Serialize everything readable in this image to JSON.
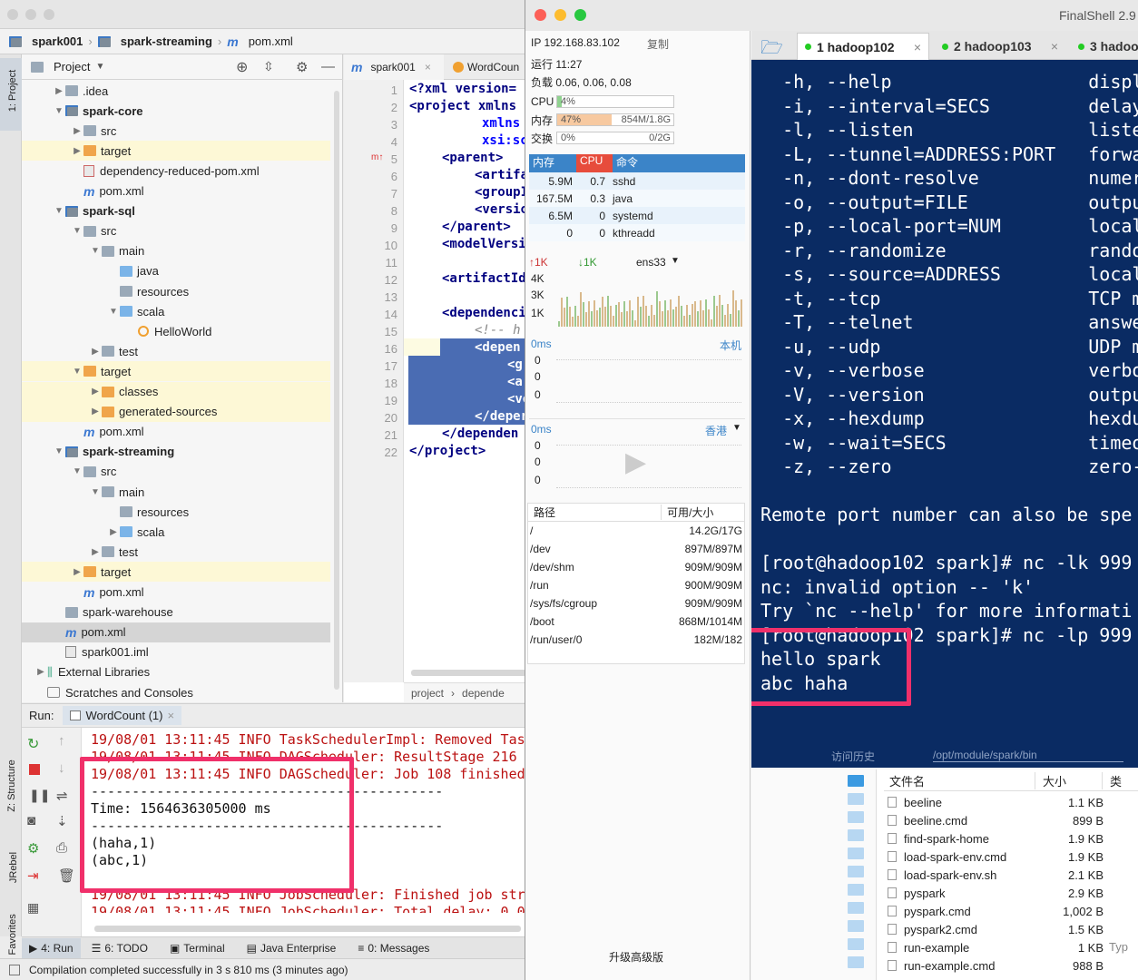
{
  "ide": {
    "breadcrumb": [
      "spark001",
      "spark-streaming",
      "pom.xml"
    ],
    "sidebar_left": {
      "project": "1: Project",
      "structure": "Z: Structure",
      "jrebel": "JRebel",
      "favorites": "2: Favorites"
    },
    "project_header": "Project",
    "tree": [
      {
        "label": ".idea",
        "depth": 1,
        "arrow": "▶",
        "icon": "fold"
      },
      {
        "label": "spark-core",
        "depth": 1,
        "arrow": "▼",
        "icon": "mod",
        "bold": true
      },
      {
        "label": "src",
        "depth": 2,
        "arrow": "▶",
        "icon": "fold"
      },
      {
        "label": "target",
        "depth": 2,
        "arrow": "▶",
        "icon": "fold orange",
        "hl": true
      },
      {
        "label": "dependency-reduced-pom.xml",
        "depth": 2,
        "arrow": "",
        "icon": "xml"
      },
      {
        "label": "pom.xml",
        "depth": 2,
        "arrow": "",
        "icon": "m"
      },
      {
        "label": "spark-sql",
        "depth": 1,
        "arrow": "▼",
        "icon": "mod",
        "bold": true
      },
      {
        "label": "src",
        "depth": 2,
        "arrow": "▼",
        "icon": "fold"
      },
      {
        "label": "main",
        "depth": 3,
        "arrow": "▼",
        "icon": "fold"
      },
      {
        "label": "java",
        "depth": 4,
        "arrow": "",
        "icon": "fold blue"
      },
      {
        "label": "resources",
        "depth": 4,
        "arrow": "",
        "icon": "fold"
      },
      {
        "label": "scala",
        "depth": 4,
        "arrow": "▼",
        "icon": "fold blue"
      },
      {
        "label": "HelloWorld",
        "depth": 5,
        "arrow": "",
        "icon": "obj"
      },
      {
        "label": "test",
        "depth": 3,
        "arrow": "▶",
        "icon": "fold"
      },
      {
        "label": "target",
        "depth": 2,
        "arrow": "▼",
        "icon": "fold orange",
        "hl": true
      },
      {
        "label": "classes",
        "depth": 3,
        "arrow": "▶",
        "icon": "fold orange",
        "hl": true
      },
      {
        "label": "generated-sources",
        "depth": 3,
        "arrow": "▶",
        "icon": "fold orange",
        "hl": true
      },
      {
        "label": "pom.xml",
        "depth": 2,
        "arrow": "",
        "icon": "m"
      },
      {
        "label": "spark-streaming",
        "depth": 1,
        "arrow": "▼",
        "icon": "mod",
        "bold": true
      },
      {
        "label": "src",
        "depth": 2,
        "arrow": "▼",
        "icon": "fold"
      },
      {
        "label": "main",
        "depth": 3,
        "arrow": "▼",
        "icon": "fold"
      },
      {
        "label": "resources",
        "depth": 4,
        "arrow": "",
        "icon": "fold"
      },
      {
        "label": "scala",
        "depth": 4,
        "arrow": "▶",
        "icon": "fold blue"
      },
      {
        "label": "test",
        "depth": 3,
        "arrow": "▶",
        "icon": "fold"
      },
      {
        "label": "target",
        "depth": 2,
        "arrow": "▶",
        "icon": "fold orange",
        "hl": true
      },
      {
        "label": "pom.xml",
        "depth": 2,
        "arrow": "",
        "icon": "m"
      },
      {
        "label": "spark-warehouse",
        "depth": 1,
        "arrow": "",
        "icon": "fold"
      },
      {
        "label": "pom.xml",
        "depth": 1,
        "arrow": "",
        "icon": "m",
        "sel": true
      },
      {
        "label": "spark001.iml",
        "depth": 1,
        "arrow": "",
        "icon": "iml"
      },
      {
        "label": "External Libraries",
        "depth": 0,
        "arrow": "▶",
        "icon": "lib"
      },
      {
        "label": "Scratches and Consoles",
        "depth": 0,
        "arrow": "",
        "icon": "scr"
      }
    ],
    "editor_tabs": [
      "spark001",
      "WordCoun"
    ],
    "line_numbers": [
      "1",
      "2",
      "3",
      "4",
      "5",
      "6",
      "7",
      "8",
      "9",
      "10",
      "11",
      "12",
      "13",
      "14",
      "15",
      "16",
      "17",
      "18",
      "19",
      "20",
      "21",
      "22"
    ],
    "code": {
      "l1a": "<?xml version=",
      "l2a": "<project xmlns",
      "l3a": "xmlns",
      "l4a": "xsi:sc",
      "l5a": "<parent>",
      "l6a": "<artifa",
      "l7a": "<groupI",
      "l8a": "<versio",
      "l9a": "</parent>",
      "l10a": "<modelVersi",
      "l12a": "<artifactId",
      "l14a": "<dependenci",
      "l15a": "<!-- h",
      "l16a": "<depen",
      "l17a": "<g",
      "l18a": "<a",
      "l19a": "<ve",
      "l20a": "</deper",
      "l21a": "</dependen",
      "l22a": "</project>"
    },
    "editor_breadcrumb": [
      "project",
      "depende"
    ],
    "run": {
      "label": "Run:",
      "tab": "WordCount (1)",
      "lines": [
        {
          "t": "19/08/01 13:11:45 INFO TaskSchedulerImpl: Removed Task",
          "c": "red"
        },
        {
          "t": "19/08/01 13:11:45 INFO DAGScheduler: ResultStage 216 (",
          "c": "red"
        },
        {
          "t": "19/08/01 13:11:45 INFO DAGScheduler: Job 108 finished:",
          "c": "red"
        },
        {
          "t": "-------------------------------------------",
          "c": "black"
        },
        {
          "t": "Time: 1564636305000 ms",
          "c": "black"
        },
        {
          "t": "-------------------------------------------",
          "c": "black"
        },
        {
          "t": "(haha,1)",
          "c": "black"
        },
        {
          "t": "(abc,1)",
          "c": "black"
        },
        {
          "t": "",
          "c": "black"
        },
        {
          "t": "19/08/01 13:11:45 INFO JobScheduler: Finished job stre",
          "c": "red"
        },
        {
          "t": "19/08/01 13:11:45 INFO JobScheduler: Total delay: 0.03",
          "c": "red"
        }
      ]
    },
    "bottom_tabs": [
      "4: Run",
      "6: TODO",
      "Terminal",
      "Java Enterprise",
      "0: Messages"
    ],
    "status": "Compilation completed successfully in 3 s 810 ms (3 minutes ago)"
  },
  "fs": {
    "title": "FinalShell 2.9",
    "ip": "IP 192.168.83.102",
    "copy": "复制",
    "uptime": "运行 11:27",
    "load": "负载 0.06, 0.06, 0.08",
    "cpu": {
      "label": "CPU",
      "pct": "4%",
      "v": 0.04
    },
    "mem": {
      "label": "内存",
      "pct": "47%",
      "size": "854M/1.8G",
      "v": 0.47
    },
    "swap": {
      "label": "交换",
      "pct": "0%",
      "size": "0/2G",
      "v": 0
    },
    "proc_headers": [
      "内存",
      "CPU",
      "命令"
    ],
    "procs": [
      [
        "5.9M",
        "0.7",
        "sshd"
      ],
      [
        "167.5M",
        "0.3",
        "java"
      ],
      [
        "6.5M",
        "0",
        "systemd"
      ],
      [
        "0",
        "0",
        "kthreadd"
      ]
    ],
    "net": {
      "up": "↑1K",
      "down": "↓1K",
      "iface": "ens33",
      "ticks": [
        "4K",
        "3K",
        "1K"
      ]
    },
    "ping1": {
      "ms": "0ms",
      "label": "本机",
      "vals": [
        "0",
        "0",
        "0"
      ]
    },
    "ping2": {
      "ms": "0ms",
      "label": "香港",
      "vals": [
        "0",
        "0",
        "0"
      ]
    },
    "disk_headers": [
      "路径",
      "可用/大小"
    ],
    "disks": [
      [
        "/",
        "14.2G/17G"
      ],
      [
        "/dev",
        "897M/897M"
      ],
      [
        "/dev/shm",
        "909M/909M"
      ],
      [
        "/run",
        "900M/909M"
      ],
      [
        "/sys/fs/cgroup",
        "909M/909M"
      ],
      [
        "/boot",
        "868M/1014M"
      ],
      [
        "/run/user/0",
        "182M/182"
      ]
    ],
    "upgrade": "升级高级版",
    "tabs": [
      "1 hadoop102",
      "2 hadoop103",
      "3 hadoo"
    ],
    "term_lines": [
      "  -h, --help                  displ",
      "  -i, --interval=SECS         delay",
      "  -l, --listen                liste",
      "  -L, --tunnel=ADDRESS:PORT   forwa",
      "  -n, --dont-resolve          numer",
      "  -o, --output=FILE           outpu",
      "  -p, --local-port=NUM        local",
      "  -r, --randomize             rando",
      "  -s, --source=ADDRESS        local",
      "  -t, --tcp                   TCP m",
      "  -T, --telnet                answe",
      "  -u, --udp                   UDP m",
      "  -v, --verbose               verbo",
      "  -V, --version               outpu",
      "  -x, --hexdump               hexdu",
      "  -w, --wait=SECS             timeo",
      "  -z, --zero                  zero-",
      "",
      "Remote port number can also be spe",
      "",
      "[root@hadoop102 spark]# nc -lk 999",
      "nc: invalid option -- 'k'",
      "Try `nc --help' for more informati",
      "[root@hadoop102 spark]# nc -lp 999",
      "hello spark",
      "abc haha"
    ],
    "history": "访问历史",
    "path": "/opt/module/spark/bin",
    "file_headers": [
      "文件名",
      "大小",
      "类"
    ],
    "files": [
      [
        "beeline",
        "1.1 KB"
      ],
      [
        "beeline.cmd",
        "899 B"
      ],
      [
        "find-spark-home",
        "1.9 KB"
      ],
      [
        "load-spark-env.cmd",
        "1.9 KB"
      ],
      [
        "load-spark-env.sh",
        "2.1 KB"
      ],
      [
        "pyspark",
        "2.9 KB"
      ],
      [
        "pyspark.cmd",
        "1,002 B"
      ],
      [
        "pyspark2.cmd",
        "1.5 KB"
      ],
      [
        "run-example",
        "1 KB"
      ],
      [
        "run-example.cmd",
        "988 B"
      ]
    ],
    "typ": "Typ"
  }
}
